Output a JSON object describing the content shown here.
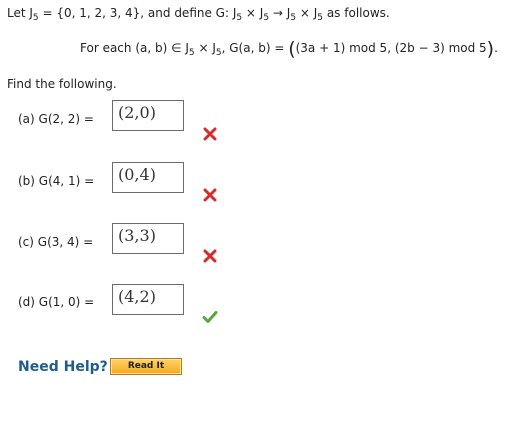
{
  "problem": {
    "intro_let": "Let J",
    "intro_sub": "5",
    "intro_set": " = {0, 1, 2, 3, 4}, and define G: J",
    "intro_s1": "5",
    "intro_x1": " × J",
    "intro_s2": "5",
    "intro_arrow": " → J",
    "intro_s3": "5",
    "intro_x2": " × J",
    "intro_s4": "5",
    "intro_end": " as follows.",
    "def_start": "For each (a, b) ∈ J",
    "def_s1": "5",
    "def_x": " × J",
    "def_s2": "5",
    "def_mid": ", G(a, b) = ",
    "def_open": "(",
    "def_formula": "(3a + 1) mod 5, (2b − 3) mod 5",
    "def_close": ")",
    "def_period": ".",
    "find": "Find the following."
  },
  "parts": [
    {
      "label": "(a)  G(2, 2) =",
      "value": "(2,0)",
      "status": "incorrect"
    },
    {
      "label": "(b)  G(4, 1) =",
      "value": "(0,4)",
      "status": "incorrect"
    },
    {
      "label": "(c)  G(3, 4) =",
      "value": "(3,3)",
      "status": "incorrect"
    },
    {
      "label": "(d)  G(1, 0) =",
      "value": "(4,2)",
      "status": "correct"
    }
  ],
  "help": {
    "need_help": "Need Help?",
    "read_it": "Read It"
  },
  "colors": {
    "incorrect": "#d42b2b",
    "correct": "#5aa83a",
    "need_help": "#1f5d8b"
  }
}
